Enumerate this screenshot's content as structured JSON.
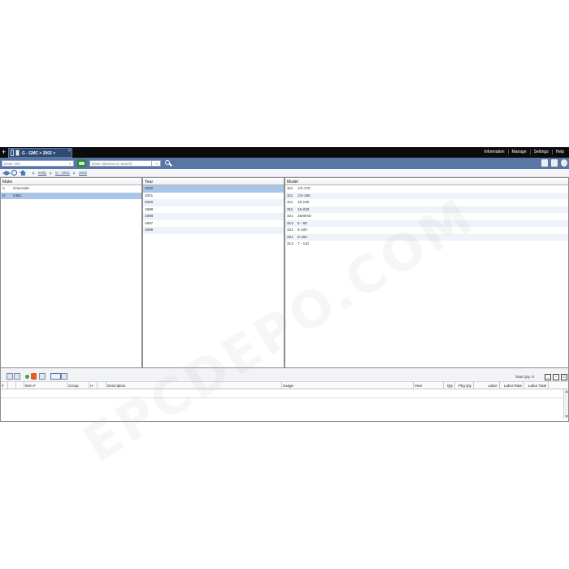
{
  "topbar": {
    "tab_label": "G - GMC > 2002 >",
    "tab_close": "×",
    "menus": [
      "Information",
      "Manage",
      "Settings",
      "Help"
    ]
  },
  "toolbar": {
    "vin_placeholder": "Enter VIN",
    "search_placeholder": "Enter Shortcut or Search"
  },
  "breadcrumb": {
    "items": [
      "emfp",
      "G - GMC",
      "2002"
    ]
  },
  "make_pane": {
    "header": "Make",
    "rows": [
      {
        "code": "C",
        "name": "Chevrolet",
        "selected": false
      },
      {
        "code": "G",
        "name": "GMC",
        "selected": true
      }
    ]
  },
  "year_pane": {
    "header": "Year",
    "rows": [
      "2002",
      "2001",
      "2000",
      "1999",
      "1998",
      "1997",
      "1996"
    ],
    "selected_index": 0
  },
  "model_pane": {
    "header": "Model",
    "rows": [
      {
        "code": "311",
        "name": "1/2-170"
      },
      {
        "code": "311",
        "name": "1/4-190"
      },
      {
        "code": "311",
        "name": "15-190"
      },
      {
        "code": "311",
        "name": "16-220"
      },
      {
        "code": "321",
        "name": "2500HD"
      },
      {
        "code": "312",
        "name": "5 - 90"
      },
      {
        "code": "321",
        "name": "6-100"
      },
      {
        "code": "321",
        "name": "6-150"
      },
      {
        "code": "313",
        "name": "7 - 110"
      }
    ]
  },
  "parts_grid": {
    "total_qty": "Total Qty: 0",
    "columns": [
      "#",
      "",
      "",
      "Item #",
      "Group",
      "H",
      "",
      "Description",
      "Usage",
      "Year",
      "Qty",
      "Pkg Qty",
      "Labor",
      "Labor Rate",
      "Labor Total"
    ]
  },
  "watermark": "EPCDEPO.COM",
  "colors": {
    "topbar": "#0c0c0c",
    "toolbar": "#5a76a3",
    "selected_row": "#a9c5e8"
  }
}
